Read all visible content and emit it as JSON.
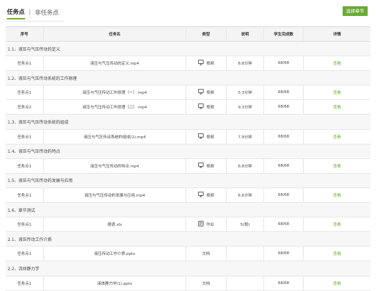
{
  "tabs": {
    "task": "任务点",
    "separator": "|",
    "nontask": "非任务点"
  },
  "select_button": "选择章节",
  "columns": {
    "no": "序号",
    "name": "任务名",
    "type": "类型",
    "desc": "说明",
    "done": "学生完成数",
    "detail": "详情"
  },
  "rows": [
    {
      "kind": "chapter",
      "title": "1.1、液压与气压传动的定义"
    },
    {
      "kind": "task",
      "no": "任务点1",
      "name": "液压与气压传动的定义.mp4",
      "icon": "monitor-icon",
      "type": "视频",
      "desc": "8.8分钟",
      "done": "68/68",
      "detail": "查看"
    },
    {
      "kind": "chapter",
      "title": "1.2、液压与气压传动系统的工作原理"
    },
    {
      "kind": "task",
      "no": "任务点1",
      "name": "液压与气压传动工作原理（一）.mp4",
      "icon": "monitor-icon",
      "type": "视频",
      "desc": "5.3分钟",
      "done": "68/68",
      "detail": "查看"
    },
    {
      "kind": "task",
      "no": "任务点2",
      "name": "液压与气压传动工作原理（二）.mp4",
      "icon": "monitor-icon",
      "type": "视频",
      "desc": "9.3分钟",
      "done": "68/68",
      "detail": "查看"
    },
    {
      "kind": "chapter",
      "title": "1.3、液压与气压传动系统的组成"
    },
    {
      "kind": "task",
      "no": "任务点1",
      "name": "液压与气压传动系统的组成(2).mp4",
      "icon": "monitor-icon",
      "type": "视频",
      "desc": "7.9分钟",
      "done": "68/68",
      "detail": "查看"
    },
    {
      "kind": "chapter",
      "title": "1.4、液压与气压传动的特点"
    },
    {
      "kind": "task",
      "no": "任务点1",
      "name": "液压与气压传动的特点.mp4",
      "icon": "monitor-icon",
      "type": "视频",
      "desc": "6.8分钟",
      "done": "68/68",
      "detail": "查看"
    },
    {
      "kind": "chapter",
      "title": "1.5、液压与气压传动的发展与应用"
    },
    {
      "kind": "task",
      "no": "任务点1",
      "name": "液压与气压传动的发展与应用.mp4",
      "icon": "monitor-icon",
      "type": "视频",
      "desc": "6.6分钟",
      "done": "68/68",
      "detail": "查看"
    },
    {
      "kind": "chapter",
      "title": "1.6、章节测试"
    },
    {
      "kind": "task",
      "no": "任务点1",
      "name": "德语.xls",
      "icon": "document-icon",
      "type": "作业",
      "desc": "5(题)",
      "done": "68/68",
      "detail": "查看"
    },
    {
      "kind": "chapter",
      "title": "2.1、液压传动工作介质"
    },
    {
      "kind": "task",
      "no": "任务点1",
      "name": "液压传动工作介质.pptx",
      "icon": "",
      "type": "文档",
      "desc": "",
      "done": "68/68",
      "detail": "查看"
    },
    {
      "kind": "chapter",
      "title": "2.2、流体静力学"
    },
    {
      "kind": "task",
      "no": "任务点1",
      "name": "液体静力学(1).pptx",
      "icon": "",
      "type": "文档",
      "desc": "",
      "done": "68/68",
      "detail": "查看"
    }
  ],
  "colors": {
    "accent": "#6aab32",
    "header_bg": "#f4f4f4",
    "chapter_bg": "#f7f7f7"
  }
}
